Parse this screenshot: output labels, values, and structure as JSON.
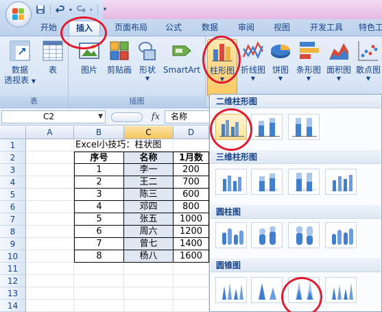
{
  "colors": {
    "accent": "#15428b",
    "highlight": "#f7c65b",
    "annotation": "#e3182d"
  },
  "quick_access": {
    "save_icon": "save-icon",
    "undo_icon": "undo-icon",
    "redo_icon": "redo-icon"
  },
  "tabs": [
    "开始",
    "插入",
    "页面布局",
    "公式",
    "数据",
    "审阅",
    "视图",
    "开发工具",
    "特色工"
  ],
  "active_tab": "插入",
  "ribbon": {
    "groups": [
      {
        "label": "表",
        "buttons": [
          "数据\n透视表",
          "表"
        ]
      },
      {
        "label": "插图",
        "buttons": [
          "图片",
          "剪贴画",
          "形状",
          "SmartArt"
        ]
      },
      {
        "label": "",
        "buttons": [
          "柱形图",
          "折线图",
          "饼图",
          "条形图",
          "面积图",
          "散点图"
        ]
      }
    ],
    "pivot_label_1": "数据",
    "pivot_label_2": "透视表",
    "table_label": "表",
    "group_table": "表",
    "picture_label": "图片",
    "clipart_label": "剪贴画",
    "shapes_label": "形状",
    "smartart_label": "SmartArt",
    "group_illustrations": "插图",
    "column_chart_label": "柱形图",
    "line_chart_label": "折线图",
    "pie_chart_label": "饼图",
    "bar_chart_label": "条形图",
    "area_chart_label": "面积图",
    "scatter_chart_label": "散点图"
  },
  "formula_bar": {
    "name_box": "C2",
    "fx": "fx",
    "content": "名称"
  },
  "columns": [
    "A",
    "B",
    "C",
    "D"
  ],
  "rows": [
    "1",
    "2",
    "3",
    "4",
    "5",
    "6",
    "7",
    "8",
    "9",
    "10",
    "11",
    "12",
    "13",
    "14"
  ],
  "sheet": {
    "title_cell": "Excel小技巧：柱状图",
    "headers": [
      "序号",
      "名称",
      "1月数"
    ],
    "data": [
      [
        "1",
        "李一",
        "200"
      ],
      [
        "2",
        "王二",
        "700"
      ],
      [
        "3",
        "陈三",
        "600"
      ],
      [
        "4",
        "邓四",
        "800"
      ],
      [
        "5",
        "张五",
        "1000"
      ],
      [
        "6",
        "周六",
        "1200"
      ],
      [
        "7",
        "曾七",
        "1400"
      ],
      [
        "8",
        "杨八",
        "1600"
      ]
    ]
  },
  "gallery": {
    "sections": [
      "二维柱形图",
      "三维柱形图",
      "圆柱图",
      "圆锥图"
    ]
  }
}
